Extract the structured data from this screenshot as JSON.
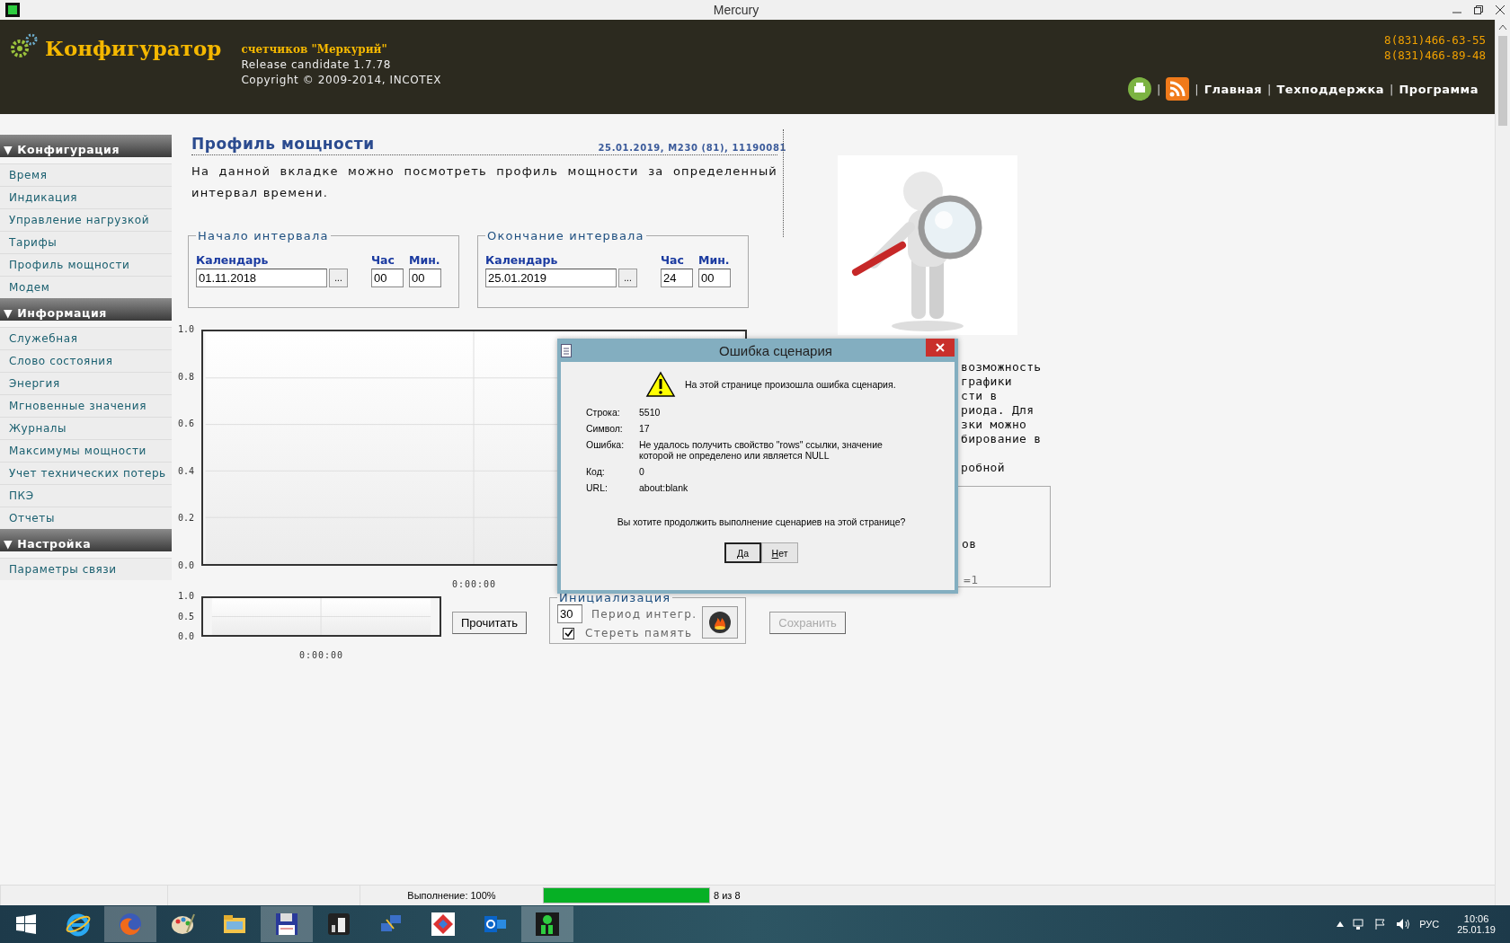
{
  "window": {
    "title": "Mercury"
  },
  "header": {
    "app_name": "Конфигуратор",
    "subtitle": "счетчиков \"Меркурий\"",
    "version": "Release candidate 1.7.78",
    "copyright": "Copyright © 2009-2014, INCOTEX",
    "phones": [
      "8(831)466-63-55",
      "8(831)466-89-48"
    ],
    "nav": [
      {
        "kind": "printer"
      },
      {
        "kind": "separator",
        "text": "|"
      },
      {
        "kind": "rss"
      },
      {
        "kind": "separator",
        "text": "|"
      },
      {
        "kind": "link",
        "text": "Главная"
      },
      {
        "kind": "separator",
        "text": "|"
      },
      {
        "kind": "link",
        "text": "Техподдержка"
      },
      {
        "kind": "separator",
        "text": "|"
      },
      {
        "kind": "link",
        "text": "Программа"
      }
    ]
  },
  "sidebar": [
    {
      "title": "Конфигурация",
      "arrow": "▼",
      "items": [
        "Время",
        "Индикация",
        "Управление нагрузкой",
        "Тарифы",
        "Профиль мощности",
        "Модем"
      ]
    },
    {
      "title": "Информация",
      "arrow": "▼",
      "items": [
        "Служебная",
        "Слово состояния",
        "Энергия",
        "Мгновенные значения",
        "Журналы",
        "Максимумы мощности",
        "Учет технических потерь",
        "ПКЭ",
        "Отчеты"
      ]
    },
    {
      "title": "Настройка",
      "arrow": "▼",
      "items": [
        "Параметры связи"
      ]
    }
  ],
  "main": {
    "title": "Профиль мощности",
    "meta": "25.01.2019, M230 (81), 11190081",
    "description": "На данной вкладке можно посмотреть профиль мощности за определенный интервал времени.",
    "intervals": [
      {
        "legend": "Начало интервала",
        "calendar_label": "Календарь",
        "date": "01.11.2018",
        "picker": "...",
        "hour_label": "Час",
        "hour": "00",
        "minute_label": "Мин.",
        "minute": "00"
      },
      {
        "legend": "Окончание интервала",
        "calendar_label": "Календарь",
        "date": "25.01.2019",
        "picker": "...",
        "hour_label": "Час",
        "hour": "24",
        "minute_label": "Мин.",
        "minute": "00"
      }
    ],
    "chart": {
      "y_labels": [
        "1.0",
        "0.8",
        "0.6",
        "0.4",
        "0.2",
        "0.0"
      ],
      "x_label": "0:00:00"
    },
    "overview_chart": {
      "y_labels": [
        "1.0",
        "0.5",
        "0.0"
      ],
      "x_label": "0:00:00"
    },
    "read_button": "Прочитать",
    "init": {
      "legend": "Инициализация",
      "period": "30",
      "period_label": "Период интегр.",
      "erase_label": "Стереть память",
      "erase_checked": true
    },
    "save_button": {
      "label": "Сохранить",
      "disabled": true
    }
  },
  "right": {
    "picture": {
      "kind": "picture"
    },
    "text_fragments": [
      "возможность",
      "графики",
      "сти в",
      "риода. Для",
      "зки можно",
      "бирование в"
    ],
    "last_fragment": "робной",
    "box_fragments": [
      "ов",
      "=1"
    ]
  },
  "dialog": {
    "title": "Ошибка сценария",
    "message": "На этой странице произошла ошибка сценария.",
    "fields": [
      {
        "label": "Строка:",
        "value": "5510"
      },
      {
        "label": "Символ:",
        "value": "17"
      },
      {
        "label": "Ошибка:",
        "value": "Не удалось получить свойство \"rows\" ссылки, значение которой не определено или является NULL"
      },
      {
        "label": "Код:",
        "value": "0"
      },
      {
        "label": "URL:",
        "value": "about:blank"
      }
    ],
    "question": "Вы хотите продолжить выполнение сценариев на этой странице?",
    "buttons": [
      {
        "label": "Да",
        "selected": true
      },
      {
        "label": "Нет",
        "selected": false
      }
    ]
  },
  "status_bar": {
    "text": "Выполнение: 100%",
    "level": 1,
    "count": "8 из 8"
  },
  "taskbar": {
    "apps": [
      {
        "kind": "ie",
        "active": false
      },
      {
        "kind": "firefox",
        "active": true
      },
      {
        "kind": "paint",
        "active": false
      },
      {
        "kind": "explorer",
        "active": false
      },
      {
        "kind": "floppy",
        "active": true
      },
      {
        "kind": "mr",
        "active": false
      },
      {
        "kind": "network",
        "active": false
      },
      {
        "kind": "diamond",
        "active": false
      },
      {
        "kind": "outlook",
        "active": false
      },
      {
        "kind": "meter",
        "active": true
      }
    ],
    "language": "РУС",
    "time": "10:06",
    "date": "25.01.19"
  }
}
